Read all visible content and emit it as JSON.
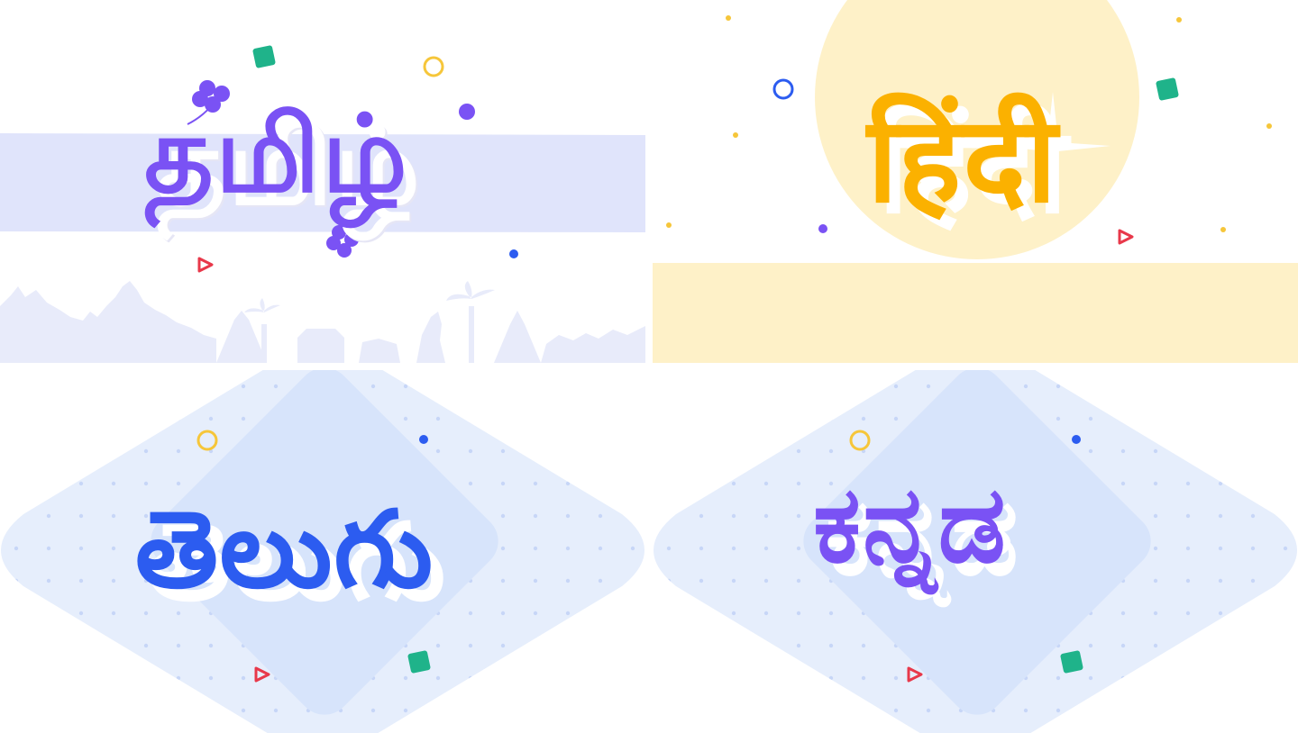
{
  "languages": [
    {
      "id": "tamil",
      "label": "தமிழ்",
      "color": "#7a52f4",
      "background": "#e0e4fb"
    },
    {
      "id": "hindi",
      "label": "हिंदी",
      "color": "#fbb100",
      "background": "#fef1c8"
    },
    {
      "id": "telugu",
      "label": "తెలుగు",
      "color": "#2c5cf0",
      "background": "#e6eefc"
    },
    {
      "id": "kannada",
      "label": "ಕನ್ನಡ",
      "color": "#7a52f4",
      "background": "#e6eefc"
    }
  ],
  "decorations": {
    "accent_green": "#1fb38a",
    "accent_yellow_ring": "#f6c63a",
    "accent_blue_dot": "#2c5cf0",
    "accent_red_play": "#e8384a",
    "icons": [
      "clover-icon",
      "ring-icon",
      "diamond-icon",
      "play-icon",
      "dot-icon",
      "sparkle-icon",
      "skyline-silhouette"
    ]
  }
}
